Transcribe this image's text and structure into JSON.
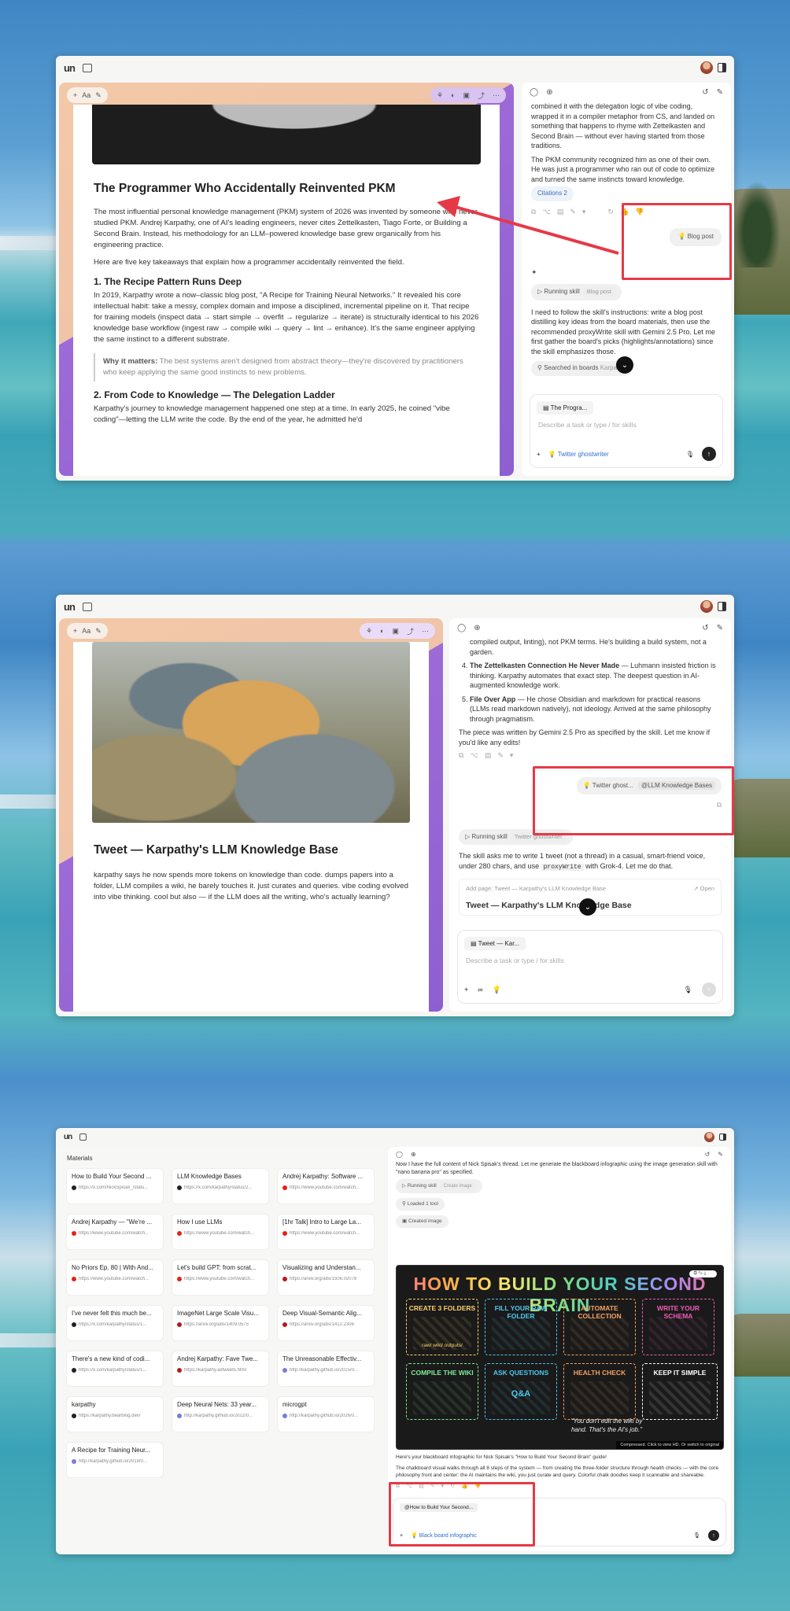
{
  "pane1": {
    "doc": {
      "title": "The Programmer Who Accidentally Reinvented PKM",
      "p1": "The most influential personal knowledge management (PKM) system of 2026 was invented by someone who never studied PKM. Andrej Karpathy, one of AI's leading engineers, never cites Zettelkasten, Tiago Forte, or Building a Second Brain. Instead, his methodology for an LLM–powered knowledge base grew organically from his engineering practice.",
      "p2": "Here are five key takeaways that explain how a programmer accidentally reinvented the field.",
      "h2a": "1. The Recipe Pattern Runs Deep",
      "p3": "In 2019, Karpathy wrote a now–classic blog post, \"A Recipe for Training Neural Networks.\" It revealed his core intellectual habit: take a messy, complex domain and impose a disciplined, incremental pipeline on it. That recipe for training models (inspect data → start simple → overfit → regularize → iterate) is structurally identical to his 2026 knowledge base workflow (ingest raw → compile wiki → query → lint → enhance). It's the same engineer applying the same instinct to a different substrate.",
      "quote_label": "Why it matters:",
      "quote_text": " The best systems aren't designed from abstract theory—they're discovered by practitioners who keep applying the same good instincts to new problems.",
      "h2b": "2. From Code to Knowledge — The Delegation Ladder",
      "p4": "Karpathy's journey to knowledge management happened one step at a time. In early 2025, he coined \"vibe coding\"—letting the LLM write the code. By the end of the year, he admitted he'd",
      "tool_plus": "+",
      "tool_aa": "Aa"
    },
    "chat": {
      "para1": "combined it with the delegation logic of vibe coding, wrapped it in a compiler metaphor from CS, and landed on something that happens to rhyme with Zettelkasten and Second Brain — without ever having started from those traditions.",
      "para2": "The PKM community recognized him as one of their own. He was just a programmer who ran out of code to optimize and turned the same instincts toward knowledge.",
      "citations": "Citations 2",
      "user_chip": "Blog post",
      "running": "Running skill",
      "running_tag": "Blog post",
      "para3": "I need to follow the skill's instructions: write a blog post distilling key ideas from the board materials, then use the recommended proxyWrite skill with Gemini 2.5 Pro. Let me first gather the board's picks (highlights/annotations) since the skill emphasizes those.",
      "searched": "Searched in boards",
      "searched_tag": "Karpathy",
      "attach": "The Progra...",
      "placeholder": "Describe a task or type / for skills",
      "skill": "Twitter ghostwriter"
    }
  },
  "pane2": {
    "doc": {
      "title": "Tweet — Karpathy's LLM Knowledge Base",
      "body": "karpathy says he now spends more tokens on knowledge than code. dumps papers into a folder, LLM compiles a wiki, he barely touches it. just curates and queries. vibe coding evolved into vibe thinking. cool but also — if the LLM does all the writing, who's actually learning?"
    },
    "chat": {
      "top": "compiled output, linting), not PKM terms. He's building a build system, not a garden.",
      "item4_num": "4.",
      "item4_title": "The Zettelkasten Connection He Never Made",
      "item4_text": " — Luhmann insisted friction is thinking. Karpathy automates that exact step. The deepest question in AI-augmented knowledge work.",
      "item5_num": "5.",
      "item5_title": "File Over App",
      "item5_text": " — He chose Obsidian and markdown for practical reasons (LLMs read markdown natively), not ideology. Arrived at the same philosophy through pragmatism.",
      "summary": "The piece was written by Gemini 2.5 Pro as specified by the skill. Let me know if you'd like any edits!",
      "user_chip1": "Twitter ghost...",
      "user_chip2": "@LLM Knowledge Bases",
      "running": "Running skill",
      "running_tag": "Twitter ghostwriter",
      "para": "The skill asks me to write 1 tweet (not a thread) in a casual, smart-friend voice, under 280 chars, and use",
      "code": "proxyWrite",
      "para_end": "with Grok-4. Let me do that.",
      "add_page": "Add page: Tweet — Karpathy's LLM Knowledge Base",
      "open": "Open",
      "card_title": "Tweet — Karpathy's LLM Knowledge Base",
      "attach": "Tweet — Kar...",
      "placeholder": "Describe a task or type / for skills"
    }
  },
  "pane3": {
    "materials_label": "Materials",
    "materials": [
      {
        "title": "How to Build Your Second ...",
        "url": "https://x.com/NickSpisak_/statu...",
        "color": "#222"
      },
      {
        "title": "LLM Knowledge Bases",
        "url": "https://x.com/karpathy/status/2...",
        "color": "#222"
      },
      {
        "title": "Andrej Karpathy: Software ...",
        "url": "https://www.youtube.com/watch...",
        "color": "#e62117"
      },
      {
        "title": "Andrej Karpathy — \"We're ...",
        "url": "https://www.youtube.com/watch...",
        "color": "#e62117"
      },
      {
        "title": "How I use LLMs",
        "url": "https://www.youtube.com/watch...",
        "color": "#e62117"
      },
      {
        "title": "[1hr Talk] Intro to Large La...",
        "url": "https://www.youtube.com/watch...",
        "color": "#e62117"
      },
      {
        "title": "No Priors Ep. 80 | With And...",
        "url": "https://www.youtube.com/watch...",
        "color": "#e62117"
      },
      {
        "title": "Let's build GPT: from scrat...",
        "url": "https://www.youtube.com/watch...",
        "color": "#e62117"
      },
      {
        "title": "Visualizing and Understan...",
        "url": "https://arxiv.org/abs/1506.02078",
        "color": "#b31b1b"
      },
      {
        "title": "I've never felt this much be...",
        "url": "https://x.com/karpathy/status/1...",
        "color": "#222"
      },
      {
        "title": "ImageNet Large Scale Visu...",
        "url": "https://arxiv.org/abs/1409.0575",
        "color": "#b31b1b"
      },
      {
        "title": "Deep Visual-Semantic Alig...",
        "url": "https://arxiv.org/abs/1412.2306",
        "color": "#b31b1b"
      },
      {
        "title": "There's a new kind of codi...",
        "url": "https://x.com/karpathy/status/1...",
        "color": "#222"
      },
      {
        "title": "Andrej Karpathy: Fave Twe...",
        "url": "https://karpathy.ai/tweets.html",
        "color": "#b31b1b"
      },
      {
        "title": "The Unreasonable Effectiv...",
        "url": "http://karpathy.github.io/2015/0...",
        "color": "#7b7bd6"
      },
      {
        "title": "karpathy",
        "url": "https://karpathy.bearblog.dev/",
        "color": "#222"
      },
      {
        "title": "Deep Neural Nets: 33 year...",
        "url": "http://karpathy.github.io/2022/0...",
        "color": "#7b7bd6"
      },
      {
        "title": "microgpt",
        "url": "http://karpathy.github.io/2026/0...",
        "color": "#7b7bd6"
      },
      {
        "title": "A Recipe for Training Neur...",
        "url": "http://karpathy.github.io/2019/0...",
        "color": "#7b7bd6"
      }
    ],
    "chat": {
      "intro": "Now I have the full content of Nick Spisak's thread. Let me generate the blackboard infographic using the image generation skill with \"nano banana pro\" as specified.",
      "running": "Running skill",
      "running_tag": "Create image",
      "loaded": "Loaded 1 tool",
      "created": "Created image",
      "bb_title": "HOW TO BUILD YOUR SECOND BRAIN",
      "cells": [
        {
          "label": "CREATE 3 FOLDERS",
          "color": "#ffd166"
        },
        {
          "label": "FILL YOUR RAW FOLDER",
          "color": "#4cc9f0"
        },
        {
          "label": "AUTOMATE COLLECTION",
          "color": "#f4a261"
        },
        {
          "label": "WRITE YOUR SCHEMA",
          "color": "#f15bb5"
        },
        {
          "label": "COMPILE THE WIKI",
          "color": "#80ed99"
        },
        {
          "label": "ASK QUESTIONS",
          "color": "#4cc9f0"
        },
        {
          "label": "HEALTH CHECK",
          "color": "#f4a261"
        },
        {
          "label": "KEEP IT SIMPLE",
          "color": "#ffffff"
        }
      ],
      "folders": "raw/   wiki/   outputs/",
      "qa": "Q&A",
      "bb_quote": "\"You don't edit the wiki by hand. That's the AI's job.\"",
      "compressed": "Compressed. Click to view HD. Or switch to original",
      "done": "Here's your blackboard infographic for Nick Spisak's \"How to Build Your Second Brain\" guide!",
      "desc": "The chalkboard visual walks through all 8 steps of the system — from creating the three-folder structure through health checks — with the core philosophy front and center: the AI maintains the wiki, you just curate and query. Colorful chalk doodles keep it scannable and shareable.",
      "attach": "@How to Build Your Second...",
      "skill": "Black board infographic"
    }
  }
}
